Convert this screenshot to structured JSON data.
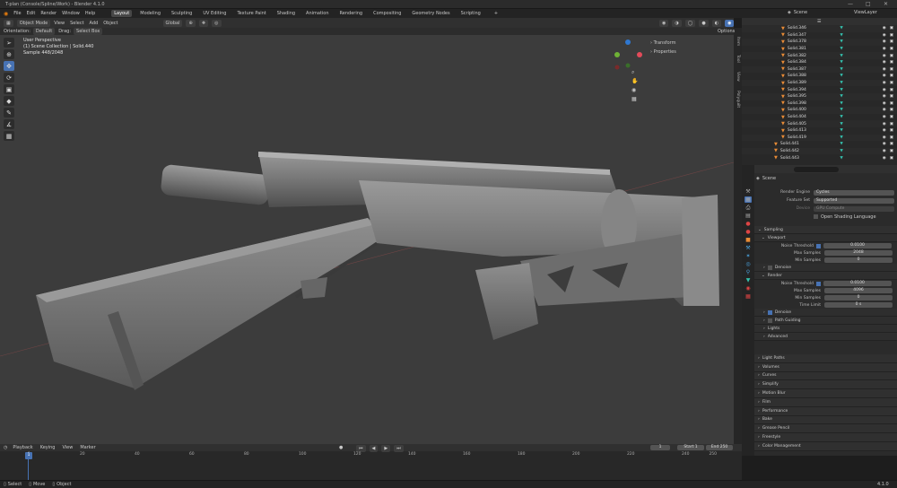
{
  "window": {
    "title": "T-plan (Console/Spline/Work) - Blender 4.1.0"
  },
  "menu": {
    "items": [
      "File",
      "Edit",
      "Render",
      "Window",
      "Help"
    ]
  },
  "workspaces": [
    "Layout",
    "Modeling",
    "Sculpting",
    "UV Editing",
    "Texture Paint",
    "Shading",
    "Animation",
    "Rendering",
    "Compositing",
    "Geometry Nodes",
    "Scripting"
  ],
  "active_workspace": "Layout",
  "header_right": {
    "scene": "Scene",
    "view_layer": "ViewLayer"
  },
  "viewport_header": {
    "mode": "Object Mode",
    "view": "View",
    "select": "Select",
    "add": "Add",
    "object": "Object",
    "orientation_label": "Orientation:",
    "orientation": "Default",
    "drag_label": "Drag:",
    "drag": "Select Box",
    "transform": "Global",
    "options": "Options"
  },
  "viewport_info": {
    "line1": "User Perspective",
    "line2": "(1) Scene Collection | Solid.440",
    "line3": "Sample 448/2048"
  },
  "viewport_panels": [
    "Transform",
    "Properties"
  ],
  "side_tabs": [
    "Item",
    "Tool",
    "View",
    "Polyquilt"
  ],
  "outliner": {
    "items": [
      "Solid.346",
      "Solid.347",
      "Solid.378",
      "Solid.381",
      "Solid.382",
      "Solid.384",
      "Solid.387",
      "Solid.388",
      "Solid.389",
      "Solid.394",
      "Solid.395",
      "Solid.398",
      "Solid.400",
      "Solid.404",
      "Solid.405",
      "Solid.413",
      "Solid.419",
      "Solid.441",
      "Solid.442",
      "Solid.443"
    ]
  },
  "properties": {
    "search_placeholder": "",
    "scene_name": "Scene",
    "render_engine_label": "Render Engine",
    "render_engine": "Cycles",
    "feature_set_label": "Feature Set",
    "feature_set": "Supported",
    "device_label": "Device",
    "device": "GPU Compute",
    "osl_label": "Open Shading Language",
    "sampling": "Sampling",
    "viewport": "Viewport",
    "vp_noise_label": "Noise Threshold",
    "vp_noise": "0.0100",
    "vp_max_label": "Max Samples",
    "vp_max": "2048",
    "vp_min_label": "Min Samples",
    "vp_min": "0",
    "vp_denoise": "Denoise",
    "render": "Render",
    "r_noise_label": "Noise Threshold",
    "r_noise": "0.0100",
    "r_max_label": "Max Samples",
    "r_max": "4096",
    "r_min_label": "Min Samples",
    "r_min": "0",
    "r_time_label": "Time Limit",
    "r_time": "0 s",
    "r_denoise": "Denoise",
    "path_guiding": "Path Guiding",
    "lights": "Lights",
    "advanced": "Advanced",
    "collapsed": [
      "Light Paths",
      "Volumes",
      "Curves",
      "Simplify",
      "Motion Blur",
      "Film",
      "Performance",
      "Bake",
      "Grease Pencil",
      "Freestyle",
      "Color Management"
    ]
  },
  "timeline": {
    "playback": "Playback",
    "keying": "Keying",
    "view": "View",
    "marker": "Marker",
    "current_frame": "1",
    "start_label": "Start",
    "start": "1",
    "end_label": "End",
    "end": "250",
    "ticks": [
      "1",
      "20",
      "40",
      "60",
      "80",
      "100",
      "120",
      "140",
      "160",
      "180",
      "200",
      "220",
      "240",
      "250"
    ]
  },
  "status": {
    "select": "Select",
    "move": "Move",
    "object": "Object",
    "version": "4.1.0"
  },
  "colors": {
    "accent": "#4772b3",
    "bg_viewport": "#3c3c3c",
    "model": "#7a7a7a"
  }
}
